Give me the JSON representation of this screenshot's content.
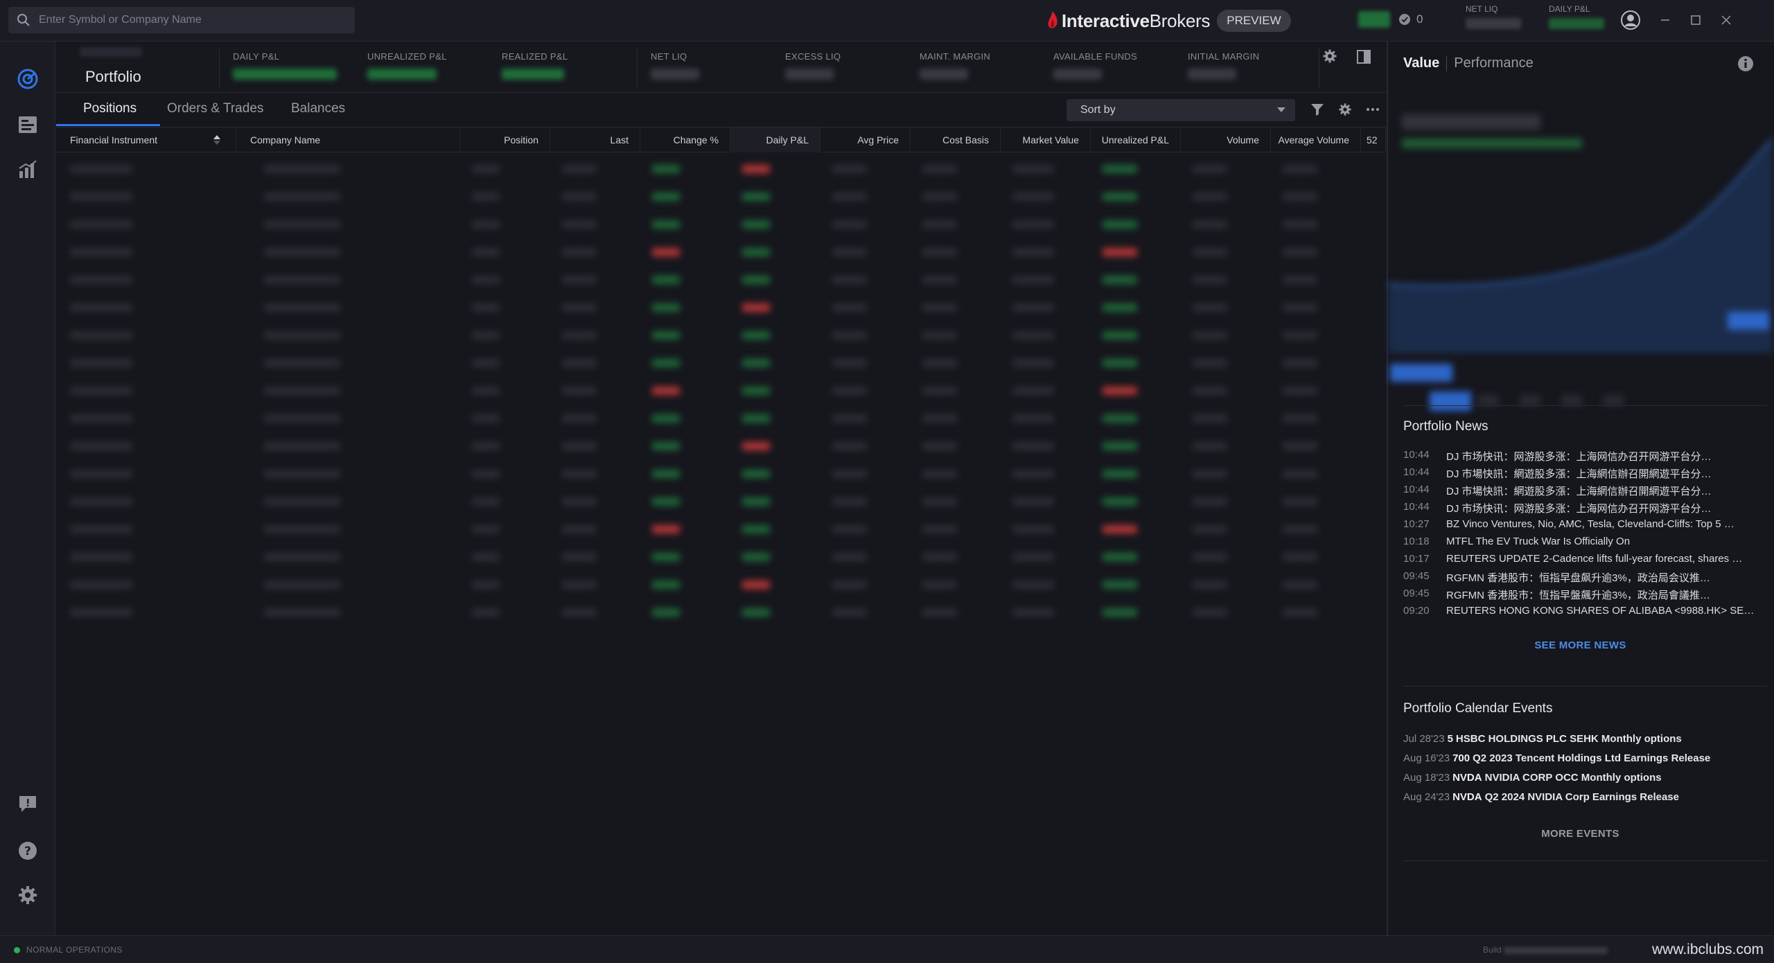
{
  "search": {
    "placeholder": "Enter Symbol or Company Name"
  },
  "brand": {
    "name_bold": "Interactive",
    "name_regular": "Brokers",
    "badge": "PREVIEW",
    "accent_color": "#d81e2c"
  },
  "top_status": {
    "alerts_count": "0"
  },
  "top_metrics": [
    {
      "label": "NET LIQ"
    },
    {
      "label": "DAILY P&L"
    }
  ],
  "portfolio": {
    "title": "Portfolio",
    "metrics": [
      {
        "label": "DAILY P&L"
      },
      {
        "label": "UNREALIZED P&L"
      },
      {
        "label": "REALIZED P&L"
      },
      {
        "label": "NET LIQ"
      },
      {
        "label": "EXCESS LIQ"
      },
      {
        "label": "MAINT. MARGIN"
      },
      {
        "label": "AVAILABLE FUNDS"
      },
      {
        "label": "INITIAL MARGIN"
      }
    ]
  },
  "tabs": [
    {
      "label": "Positions"
    },
    {
      "label": "Orders & Trades"
    },
    {
      "label": "Balances"
    }
  ],
  "sort": {
    "label": "Sort by"
  },
  "table": {
    "columns": [
      {
        "label": "Financial Instrument"
      },
      {
        "label": "Company Name"
      },
      {
        "label": "Position"
      },
      {
        "label": "Last"
      },
      {
        "label": "Change %"
      },
      {
        "label": "Daily P&L"
      },
      {
        "label": "Avg Price"
      },
      {
        "label": "Cost Basis"
      },
      {
        "label": "Market Value"
      },
      {
        "label": "Unrealized P&L"
      },
      {
        "label": "Volume"
      },
      {
        "label": "Average Volume"
      },
      {
        "label": "52"
      }
    ]
  },
  "right_panel": {
    "tabs": {
      "value": "Value",
      "performance": "Performance"
    },
    "news_title": "Portfolio News",
    "news": [
      {
        "time": "10:44",
        "text": "DJ 市场快讯：网游股多涨：上海网信办召开网游平台分…"
      },
      {
        "time": "10:44",
        "text": "DJ 市場快訊：網遊股多漲：上海網信辦召開網遊平台分…"
      },
      {
        "time": "10:44",
        "text": "DJ 市場快訊：網遊股多漲：上海網信辦召開網遊平台分…"
      },
      {
        "time": "10:44",
        "text": "DJ 市场快讯：网游股多涨：上海网信办召开网游平台分…"
      },
      {
        "time": "10:27",
        "text": "BZ Vinco Ventures, Nio, AMC, Tesla, Cleveland-Cliffs: Top 5 …"
      },
      {
        "time": "10:18",
        "text": "MTFL The EV Truck War Is Officially On"
      },
      {
        "time": "10:17",
        "text": "REUTERS UPDATE 2-Cadence lifts full-year forecast, shares …"
      },
      {
        "time": "09:45",
        "text": "RGFMN 香港股市：恒指早盘飙升逾3%，政治局会议推…"
      },
      {
        "time": "09:45",
        "text": "RGFMN 香港股市：恆指早盤飆升逾3%，政治局會議推…"
      },
      {
        "time": "09:20",
        "text": "REUTERS HONG KONG SHARES OF ALIBABA <9988.HK> SET…"
      }
    ],
    "see_more_news": "SEE MORE NEWS",
    "events_title": "Portfolio Calendar Events",
    "events": [
      {
        "date": "Jul 28'23",
        "symbol": "5",
        "text": "HSBC HOLDINGS PLC SEHK Monthly options"
      },
      {
        "date": "Aug 16'23",
        "symbol": "700",
        "text": "Q2 2023 Tencent Holdings Ltd Earnings Release"
      },
      {
        "date": "Aug 18'23",
        "symbol": "NVDA",
        "text": "NVIDIA CORP OCC Monthly options"
      },
      {
        "date": "Aug 24'23",
        "symbol": "NVDA",
        "text": "Q2 2024 NVIDIA Corp Earnings Release"
      }
    ],
    "more_events": "MORE EVENTS"
  },
  "status_bar": {
    "text": "NORMAL OPERATIONS",
    "build_prefix": "Build",
    "watermark": "www.ibclubs.com"
  },
  "colors": {
    "accent_blue": "#2e76e8",
    "positive": "#2fae57",
    "negative": "#c23a3a",
    "background": "#16161d"
  }
}
